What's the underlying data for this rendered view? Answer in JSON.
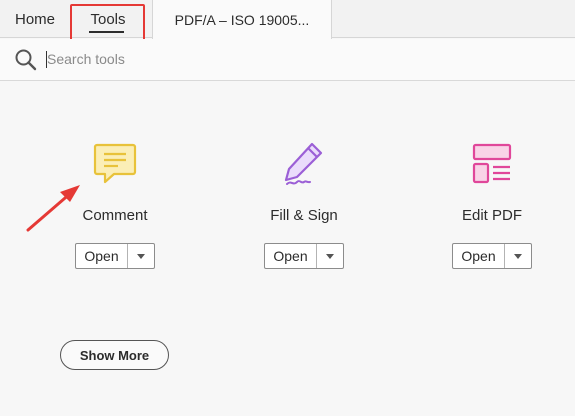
{
  "tabs": {
    "home": "Home",
    "tools": "Tools",
    "document": "PDF/A – ISO 19005..."
  },
  "search": {
    "placeholder": "Search tools",
    "icon": "search-icon"
  },
  "tools": [
    {
      "label": "Comment",
      "icon": "comment-icon",
      "color": "#e8c23a",
      "open_label": "Open"
    },
    {
      "label": "Fill & Sign",
      "icon": "fill-sign-icon",
      "color": "#9b5fd6",
      "open_label": "Open"
    },
    {
      "label": "Edit PDF",
      "icon": "edit-pdf-icon",
      "color": "#e0479a",
      "open_label": "Open"
    }
  ],
  "show_more_label": "Show More",
  "colors": {
    "annotation": "#e53935",
    "background": "#f7f7f7"
  }
}
